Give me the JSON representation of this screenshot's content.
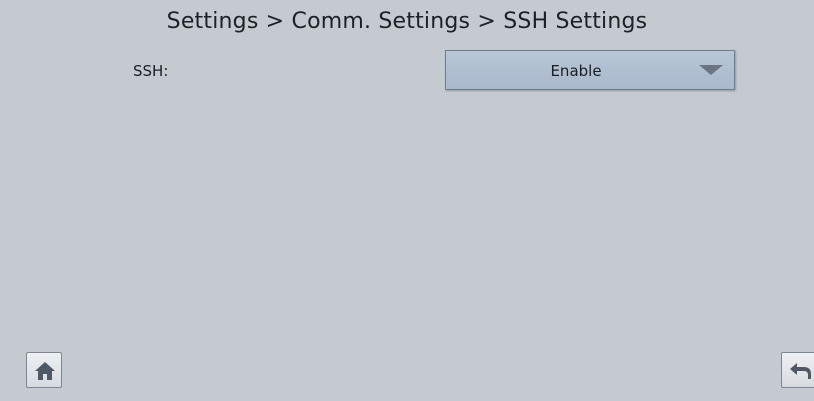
{
  "header": {
    "breadcrumb": "Settings > Comm. Settings > SSH Settings"
  },
  "ssh_setting": {
    "label": "SSH:",
    "selected_value": "Enable"
  },
  "nav": {
    "home_icon": "home-icon",
    "back_icon": "back-arrow-icon"
  },
  "colors": {
    "background": "#c5cad1",
    "dropdown": "#afbfd0",
    "arrow": "#6b7582",
    "button": "#e4e7eb"
  }
}
